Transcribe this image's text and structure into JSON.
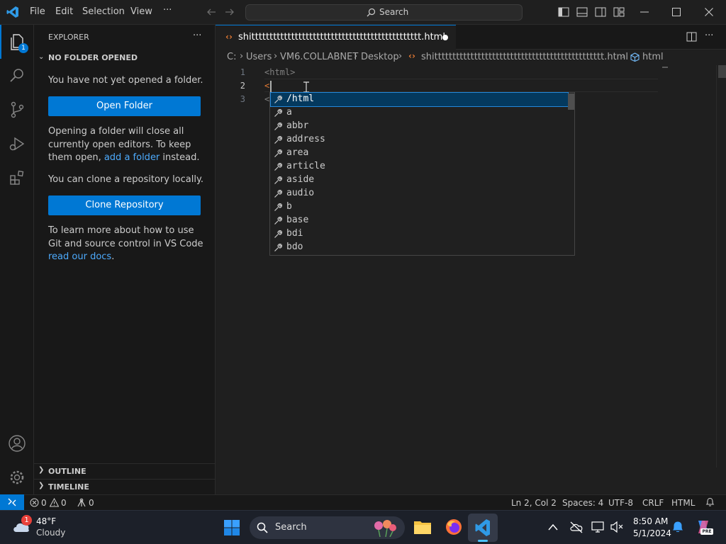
{
  "menu": {
    "file": "File",
    "edit": "Edit",
    "selection": "Selection",
    "view": "View",
    "more": "···"
  },
  "command_center": {
    "label": "Search"
  },
  "activity": {
    "explorer_badge": "1"
  },
  "sidebar": {
    "title": "EXPLORER",
    "more": "···",
    "section_title": "NO FOLDER OPENED",
    "no_folder_msg": "You have not yet opened a folder.",
    "open_folder_label": "Open Folder",
    "warning_part1": "Opening a folder will close all currently open editors. To keep them open, ",
    "warning_link": "add a folder",
    "warning_part2": " instead.",
    "clone_msg": "You can clone a repository locally.",
    "clone_label": "Clone Repository",
    "git_part1": "To learn more about how to use Git and source control in VS Code ",
    "git_link": "read our docs",
    "git_part2": ".",
    "outline": "OUTLINE",
    "timeline": "TIMELINE"
  },
  "tab": {
    "name": "shittttttttttttttttttttttttttttttttttttttttttttttt.html"
  },
  "breadcrumb": {
    "c": "C:",
    "users": "Users",
    "user": "VM6.COLLABNET",
    "desktop": "Desktop",
    "file": "shittttttttttttttttttttttttttttttttttttttttttttttt.html",
    "element": "html"
  },
  "editor": {
    "lines": [
      {
        "num": "1",
        "text": "<html>"
      },
      {
        "num": "2",
        "text": "<"
      },
      {
        "num": "3",
        "text": "<"
      }
    ]
  },
  "suggestions": [
    "/html",
    "a",
    "abbr",
    "address",
    "area",
    "article",
    "aside",
    "audio",
    "b",
    "base",
    "bdi",
    "bdo"
  ],
  "status": {
    "errors": "0",
    "warnings": "0",
    "ports": "0",
    "position": "Ln 2, Col 2",
    "spaces": "Spaces: 4",
    "encoding": "UTF-8",
    "eol": "CRLF",
    "language": "HTML"
  },
  "taskbar": {
    "weather_badge": "1",
    "temp": "48°F",
    "condition": "Cloudy",
    "search": "Search",
    "time": "8:50 AM",
    "date": "5/1/2024",
    "copilot": "PRE"
  },
  "colors": {
    "accent": "#0078d4",
    "selected": "#04395e",
    "link": "#4daafc"
  }
}
